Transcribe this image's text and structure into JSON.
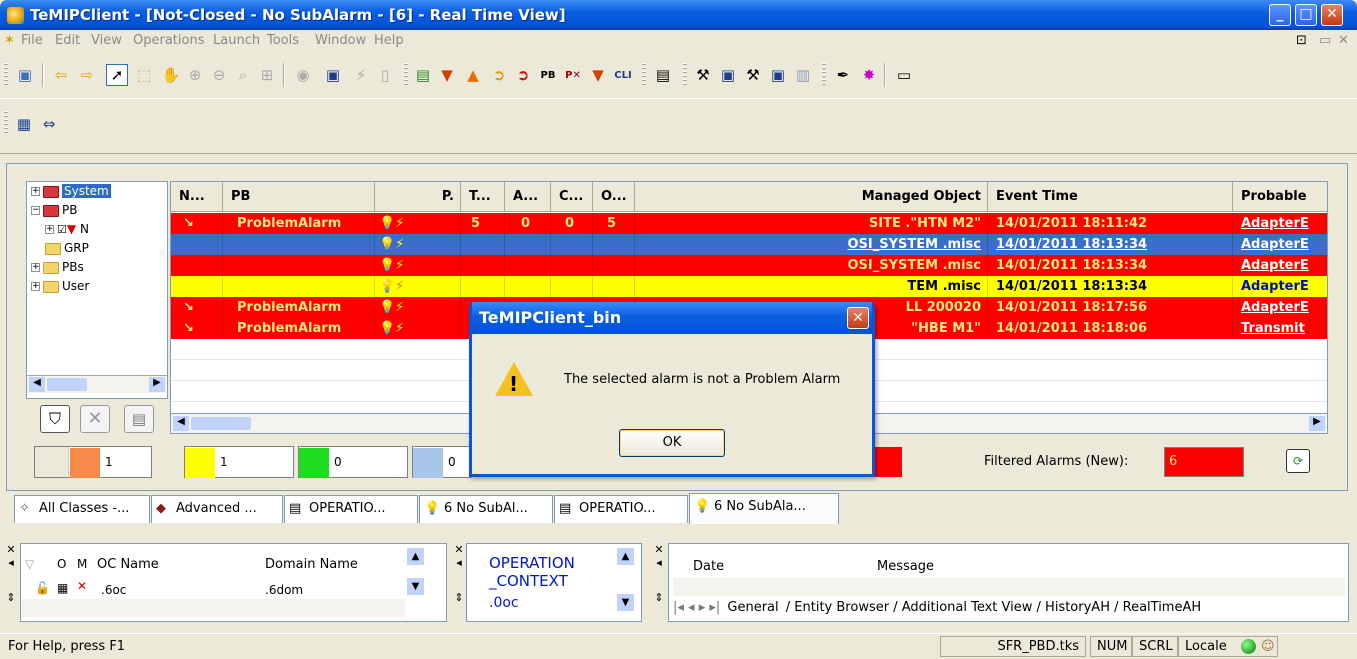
{
  "window": {
    "title": "TeMIPClient - [Not-Closed - No SubAlarm - [6] - Real Time View]"
  },
  "menu": [
    "File",
    "Edit",
    "View",
    "Operations",
    "Launch",
    "Tools",
    "Window",
    "Help"
  ],
  "tree": {
    "items": [
      {
        "label": "System"
      },
      {
        "label": "PB"
      },
      {
        "label": "N"
      },
      {
        "label": "GRP"
      },
      {
        "label": "PBs"
      },
      {
        "label": "User"
      }
    ]
  },
  "grid": {
    "columns": [
      "N...",
      "PB",
      "P.",
      "T...",
      "A...",
      "C...",
      "O...",
      "Managed Object",
      "Event Time",
      "Probable"
    ],
    "rows": [
      {
        "style": "red",
        "n": "↘",
        "pb": "ProblemAlarm",
        "t": "5",
        "a": "0",
        "c": "0",
        "o": "5",
        "mo": "SITE .\"HTN M2\"",
        "time": "14/01/2011 18:11:42",
        "prob": "AdapterE"
      },
      {
        "style": "blue",
        "n": "",
        "pb": "",
        "t": "",
        "a": "",
        "c": "",
        "o": "",
        "mo": "OSI_SYSTEM .misc",
        "time": "14/01/2011 18:13:34",
        "prob": "AdapterE"
      },
      {
        "style": "red",
        "n": "",
        "pb": "",
        "t": "",
        "a": "",
        "c": "",
        "o": "",
        "mo": "OSI_SYSTEM .misc",
        "time": "14/01/2011 18:13:34",
        "prob": "AdapterE"
      },
      {
        "style": "yellow",
        "n": "",
        "pb": "",
        "t": "",
        "a": "",
        "c": "",
        "o": "",
        "mo": "TEM .misc",
        "time": "14/01/2011 18:13:34",
        "prob": "AdapterE"
      },
      {
        "style": "red",
        "n": "↘",
        "pb": "ProblemAlarm",
        "t": "",
        "a": "",
        "c": "",
        "o": "",
        "mo": "LL 200020",
        "time": "14/01/2011 18:17:56",
        "prob": "AdapterE"
      },
      {
        "style": "red",
        "n": "↘",
        "pb": "ProblemAlarm",
        "t": "",
        "a": "",
        "c": "",
        "o": "",
        "mo": "\"HBE M1\"",
        "time": "14/01/2011 18:18:06",
        "prob": "Transmit"
      }
    ]
  },
  "summary": {
    "counts": [
      "1",
      "1",
      "0",
      "0"
    ],
    "filtered_label": "Filtered Alarms (New):",
    "filtered_value": "6"
  },
  "tabs": [
    "All Classes -...",
    "Advanced ...",
    "OPERATIO...",
    "6 No SubAl...",
    "OPERATIO...",
    "6 No SubAla..."
  ],
  "bottom": {
    "oc_headers": [
      "O",
      "M",
      "OC Name",
      "Domain Name"
    ],
    "oc_row": {
      "name": ".6oc",
      "domain": ".6dom"
    },
    "context_lines": [
      "OPERATION",
      "_CONTEXT",
      ".0oc"
    ],
    "log_headers": [
      "Date",
      "Message"
    ],
    "log_tabs": [
      "General",
      "Entity Browser",
      "Additional Text View",
      "HistoryAH",
      "RealTimeAH"
    ]
  },
  "status": {
    "help": "For Help, press F1",
    "file": "SFR_PBD.tks",
    "num": "NUM",
    "scrl": "SCRL",
    "locale": "Locale"
  },
  "dialog": {
    "title": "TeMIPClient_bin",
    "message": "The selected alarm is not a Problem Alarm",
    "ok": "OK"
  },
  "colors": {
    "critical": "#ff0000",
    "selected": "#3a6ec8",
    "warning": "#ffff00",
    "accent": "#0a5fe0"
  }
}
